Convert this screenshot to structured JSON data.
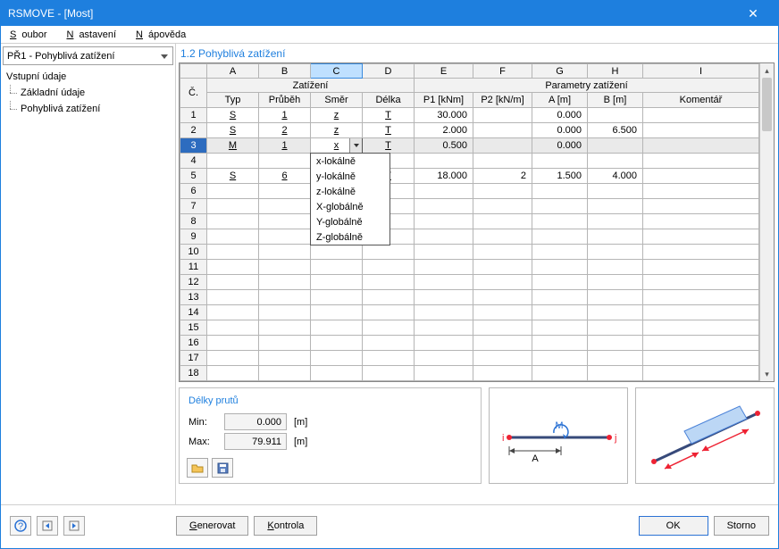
{
  "window": {
    "title": "RSMOVE - [Most]"
  },
  "menu": {
    "items": [
      "Soubor",
      "Nastavení",
      "Nápověda"
    ],
    "mnemonics": [
      "S",
      "N",
      "N"
    ]
  },
  "combo": {
    "value": "PŘ1 - Pohyblivá zatížení"
  },
  "tree": {
    "root": "Vstupní údaje",
    "children": [
      "Základní údaje",
      "Pohyblivá zatížení"
    ]
  },
  "section_title": "1.2 Pohyblivá zatížení",
  "columns": {
    "letters": [
      "A",
      "B",
      "C",
      "D",
      "E",
      "F",
      "G",
      "H",
      "I"
    ],
    "group1": "Zatížení",
    "group2": "Parametry zatížení",
    "heads": [
      "Č.",
      "Typ",
      "Průběh",
      "Směr",
      "Délka",
      "P1 [kNm]",
      "P2 [kN/m]",
      "A [m]",
      "B [m]",
      "Komentář"
    ],
    "selected_letter_index": 2
  },
  "rows": [
    {
      "n": "1",
      "typ": "S",
      "prubeh": "1",
      "smer": "z",
      "delka": "T",
      "p1": "30.000",
      "p2": "",
      "a": "0.000",
      "b": "",
      "kom": ""
    },
    {
      "n": "2",
      "typ": "S",
      "prubeh": "2",
      "smer": "z",
      "delka": "T",
      "p1": "2.000",
      "p2": "",
      "a": "0.000",
      "b": "6.500",
      "kom": ""
    },
    {
      "n": "3",
      "typ": "M",
      "prubeh": "1",
      "smer": "x",
      "delka": "T",
      "p1": "0.500",
      "p2": "",
      "a": "0.000",
      "b": "",
      "kom": "",
      "selected": true,
      "editing": true
    },
    {
      "n": "4",
      "typ": "",
      "prubeh": "",
      "smer": "",
      "delka": "",
      "p1": "",
      "p2": "",
      "a": "",
      "b": "",
      "kom": ""
    },
    {
      "n": "5",
      "typ": "S",
      "prubeh": "6",
      "smer": "",
      "delka": "T",
      "p1": "18.000",
      "p2": "2",
      "a": "1.500",
      "b": "4.000",
      "kom": ""
    },
    {
      "n": "6"
    },
    {
      "n": "7"
    },
    {
      "n": "8"
    },
    {
      "n": "9"
    },
    {
      "n": "10"
    },
    {
      "n": "11"
    },
    {
      "n": "12"
    },
    {
      "n": "13"
    },
    {
      "n": "14"
    },
    {
      "n": "15"
    },
    {
      "n": "16"
    },
    {
      "n": "17"
    },
    {
      "n": "18"
    }
  ],
  "dropdown_options": [
    "x-lokálně",
    "y-lokálně",
    "z-lokálně",
    "X-globálně",
    "Y-globálně",
    "Z-globálně"
  ],
  "info": {
    "title": "Délky prutů",
    "min_label": "Min:",
    "min": "0.000",
    "unit": "[m]",
    "max_label": "Max:",
    "max": "79.911"
  },
  "footer": {
    "generate": "Generovat",
    "generate_mn": "G",
    "check": "Kontrola",
    "check_mn": "K",
    "ok": "OK",
    "cancel": "Storno"
  }
}
